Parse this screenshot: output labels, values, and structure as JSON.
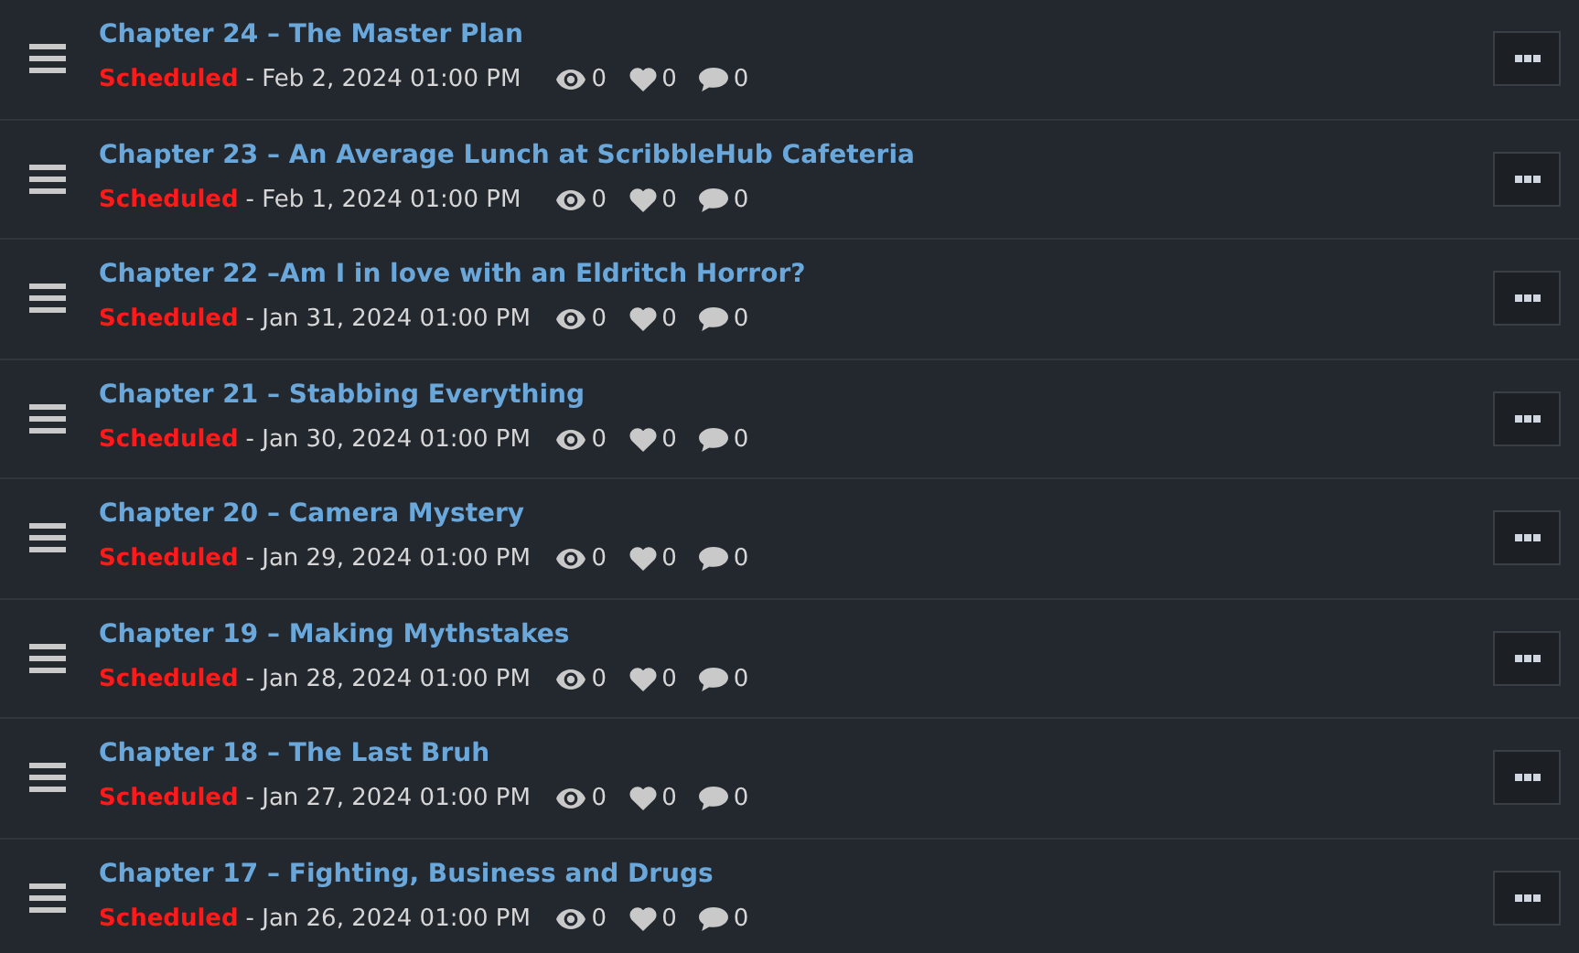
{
  "chapters": [
    {
      "title": "Chapter 24 – The Master Plan",
      "status": "Scheduled",
      "date": "- Feb 2, 2024 01:00 PM",
      "views": "0",
      "likes": "0",
      "comments": "0"
    },
    {
      "title": "Chapter 23 – An Average Lunch at ScribbleHub Cafeteria",
      "status": "Scheduled",
      "date": "- Feb 1, 2024 01:00 PM",
      "views": "0",
      "likes": "0",
      "comments": "0"
    },
    {
      "title": "Chapter 22 –Am I in love with an Eldritch Horror?",
      "status": "Scheduled",
      "date": "- Jan 31, 2024 01:00 PM",
      "views": "0",
      "likes": "0",
      "comments": "0"
    },
    {
      "title": "Chapter 21 – Stabbing Everything",
      "status": "Scheduled",
      "date": "- Jan 30, 2024 01:00 PM",
      "views": "0",
      "likes": "0",
      "comments": "0"
    },
    {
      "title": "Chapter 20 – Camera Mystery",
      "status": "Scheduled",
      "date": "- Jan 29, 2024 01:00 PM",
      "views": "0",
      "likes": "0",
      "comments": "0"
    },
    {
      "title": "Chapter 19 – Making Mythstakes",
      "status": "Scheduled",
      "date": "- Jan 28, 2024 01:00 PM",
      "views": "0",
      "likes": "0",
      "comments": "0"
    },
    {
      "title": "Chapter 18 – The Last Bruh",
      "status": "Scheduled",
      "date": "- Jan 27, 2024 01:00 PM",
      "views": "0",
      "likes": "0",
      "comments": "0"
    },
    {
      "title": "Chapter 17 – Fighting, Business and Drugs",
      "status": "Scheduled",
      "date": "- Jan 26, 2024 01:00 PM",
      "views": "0",
      "likes": "0",
      "comments": "0"
    }
  ]
}
